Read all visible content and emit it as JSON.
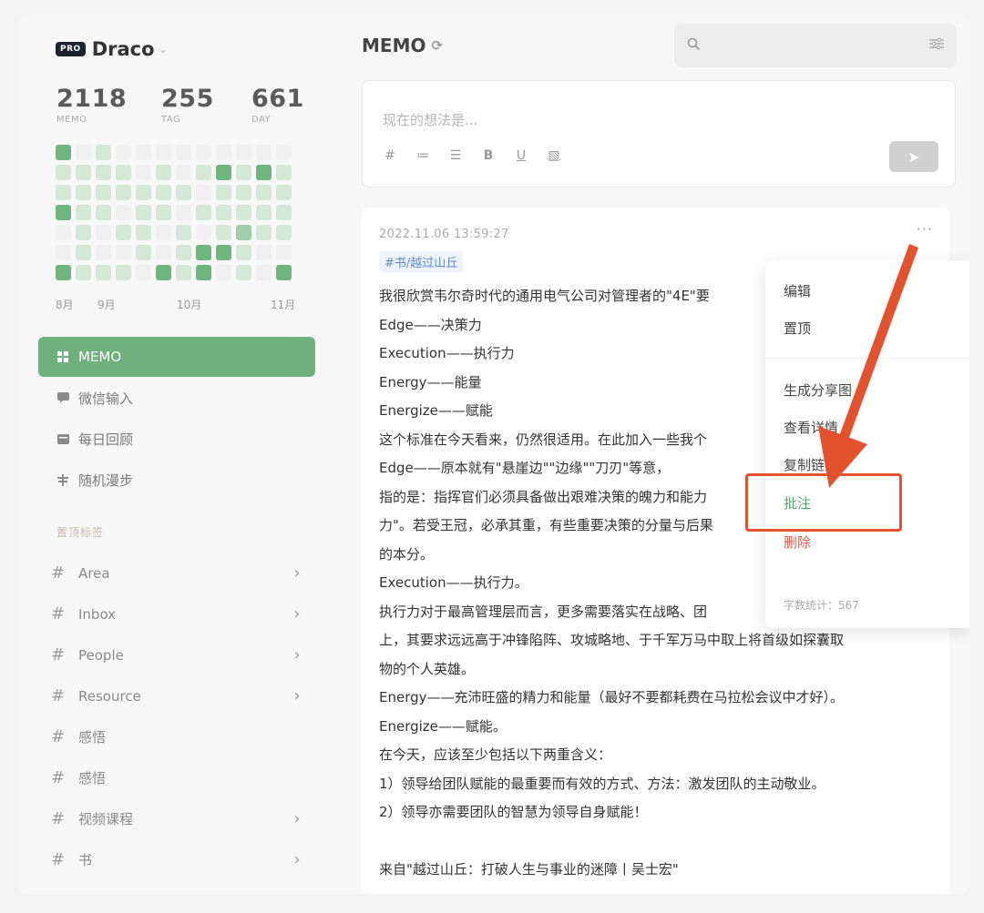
{
  "profile": {
    "badge": "PRO",
    "name": "Draco"
  },
  "stats": [
    {
      "value": "2118",
      "label": "MEMO"
    },
    {
      "value": "255",
      "label": "TAG"
    },
    {
      "value": "661",
      "label": "DAY"
    }
  ],
  "heatmap_months": [
    "8月",
    "9月",
    "10月",
    "11月"
  ],
  "nav": [
    {
      "label": "MEMO",
      "icon": "grid-icon",
      "active": true
    },
    {
      "label": "微信输入",
      "icon": "message-icon",
      "active": false
    },
    {
      "label": "每日回顾",
      "icon": "calendar-icon",
      "active": false
    },
    {
      "label": "随机漫步",
      "icon": "shuffle-icon",
      "active": false
    }
  ],
  "tags_title": "置顶标签",
  "tags": [
    {
      "label": "Area",
      "has_children": true
    },
    {
      "label": "Inbox",
      "has_children": true
    },
    {
      "label": "People",
      "has_children": true
    },
    {
      "label": "Resource",
      "has_children": true
    },
    {
      "label": "感悟",
      "has_children": false
    },
    {
      "label": "感悟",
      "has_children": false
    },
    {
      "label": "视频课程",
      "has_children": true
    },
    {
      "label": "书",
      "has_children": true
    }
  ],
  "main": {
    "title": "MEMO"
  },
  "search": {
    "placeholder": ""
  },
  "editor": {
    "placeholder": "现在的想法是...",
    "tools": [
      "#",
      "≔",
      "☰",
      "B",
      "U",
      "▧"
    ]
  },
  "memo": {
    "time": "2022.11.06 13:59:27",
    "more": "···",
    "tag": "#书/越过山丘",
    "lines": [
      "我很欣赏韦尔奇时代的通用电气公司对管理者的\"4E\"要",
      "Edge——决策力",
      "Execution——执行力",
      "Energy——能量",
      "Energize——赋能",
      "这个标准在今天看来，仍然很适用。在此加入一些我个",
      "Edge——原本就有\"悬崖边\"\"边缘\"\"刀刃\"等意，",
      "指的是：指挥官们必须具备做出艰难决策的魄力和能力",
      "力\"。若受王冠，必承其重，有些重要决策的分量与后果",
      "的本分。",
      "Execution——执行力。",
      "执行力对于最高管理层而言，更多需要落实在战略、团",
      "上，其要求远远高于冲锋陷阵、攻城略地、于千军万马中取上将首级如探囊取",
      "物的个人英雄。",
      "Energy——充沛旺盛的精力和能量（最好不要都耗费在马拉松会议中才好）。",
      "Energize——赋能。",
      "在今天，应该至少包括以下两重含义：",
      "1）领导给团队赋能的最重要而有效的方式、方法：激发团队的主动敬业。",
      "2）领导亦需要团队的智慧为领导自身赋能！",
      "",
      "来自\"越过山丘：打破人生与事业的迷障丨吴士宏\""
    ]
  },
  "menu": {
    "items": [
      "编辑",
      "置顶",
      "生成分享图",
      "查看详情",
      "复制链接",
      "批注",
      "删除"
    ],
    "footer": "字数统计：567"
  },
  "colors": {
    "accent": "#6fb07c",
    "highlight": "#e2522d",
    "delete": "#e05a4e"
  }
}
